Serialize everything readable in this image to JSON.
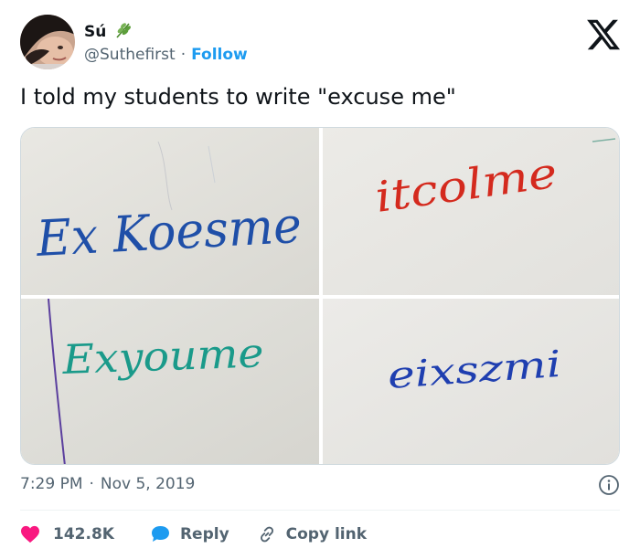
{
  "author": {
    "display_name": "Sú",
    "emoji_icon": "herb-emoji-icon",
    "handle": "@Suthefirst",
    "separator": "·",
    "follow_label": "Follow"
  },
  "tweet": {
    "text": "I told my students to write \"excuse me\""
  },
  "media": {
    "images": [
      {
        "handwriting": "Ex Koesme",
        "ink_color": "#1f4fa8"
      },
      {
        "handwriting": "itcolme",
        "ink_color": "#d42a1e"
      },
      {
        "handwriting": "Exyoume",
        "ink_color": "#1a9a8a"
      },
      {
        "handwriting": "eixszmi",
        "ink_color": "#1f3fb0"
      }
    ]
  },
  "meta": {
    "time": "7:29 PM",
    "separator": "·",
    "date": "Nov 5, 2019"
  },
  "actions": {
    "like_count": "142.8K",
    "reply_label": "Reply",
    "copy_label": "Copy link"
  },
  "colors": {
    "accent": "#1d9bf0",
    "like": "#f91880",
    "muted": "#536471",
    "text": "#0f1419"
  }
}
